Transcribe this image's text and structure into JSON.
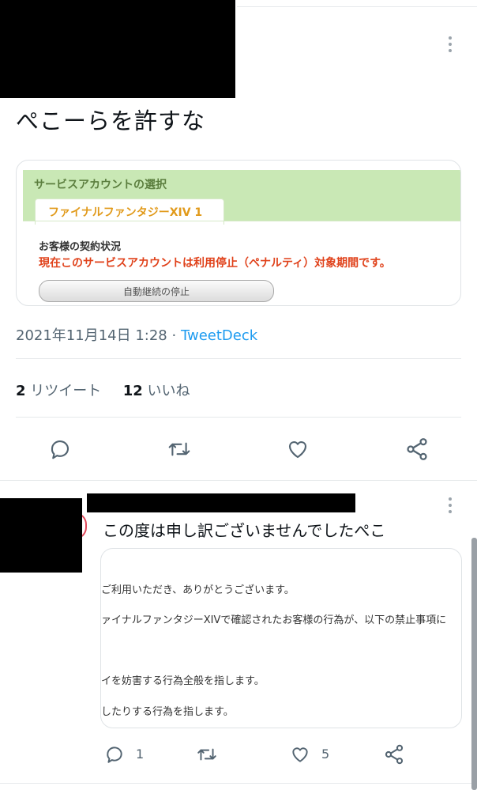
{
  "tweet": {
    "text": "ぺこーらを許すな",
    "card": {
      "header_title": "サービスアカウントの選択",
      "tab_label": "ファイナルファンタジーXIV 1",
      "status_label": "お客様の契約状況",
      "status_message": "現在このサービスアカウントは利用停止（ペナルティ）対象期間です。",
      "button_label": "自動継続の停止"
    },
    "date": "2021年11月14日 1:28",
    "separator": "·",
    "source": "TweetDeck",
    "retweets_count": "2",
    "retweets_label": "リツイート",
    "likes_count": "12",
    "likes_label": "いいね"
  },
  "reply": {
    "text": "この度は申し訳ございませんでしたぺこ",
    "card_lines": [
      "ご利用いただき、ありがとうございます。",
      "ァイナルファンタジーXIVで確認されたお客様の行為が、以下の禁止事項に",
      "イを妨害する行為全般を指します。",
      "したりする行為を指します。"
    ],
    "reply_count": "1",
    "like_count": "5"
  },
  "colors": {
    "accent": "#1d9bf0",
    "penalty_red": "#e0421b",
    "card_green": "#c9e8b5",
    "tab_orange": "#e19a1b"
  },
  "icons": [
    "more-icon",
    "reply-icon",
    "retweet-icon",
    "like-icon",
    "share-icon"
  ]
}
